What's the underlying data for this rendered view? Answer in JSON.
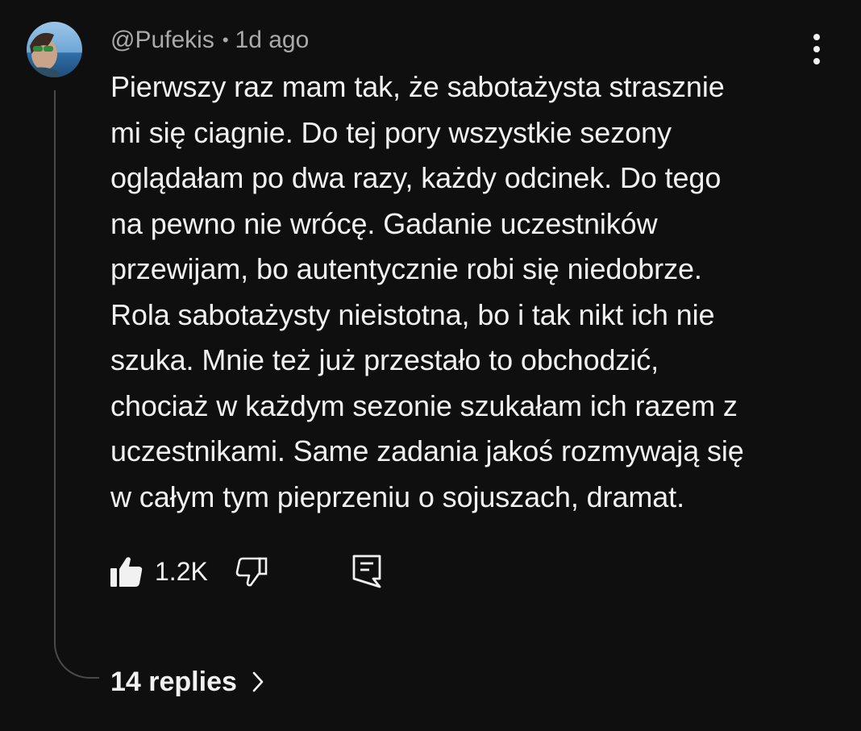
{
  "comment": {
    "author": "@Pufekis",
    "separator": "•",
    "time": "1d ago",
    "lines": [
      "Pierwszy raz mam tak, że sabotażysta strasznie",
      "mi się ciagnie. Do tej pory wszystkie sezony",
      "oglądałam po dwa razy, każdy odcinek. Do tego",
      "na pewno nie wrócę. Gadanie uczestników",
      "przewijam, bo autentycznie robi się niedobrze.",
      "Rola sabotażysty nieistotna, bo i tak nikt ich nie",
      "szuka. Mnie też już przestało to obchodzić,",
      "chociaż w każdym sezonie szukałam ich razem z",
      "uczestnikami. Same zadania jakoś rozmywają się",
      "w całym tym pieprzeniu o sojuszach, dramat."
    ],
    "like_count": "1.2K",
    "replies_label": "14 replies"
  },
  "icons": {
    "avatar": "avatar",
    "menu": "more-vert-icon",
    "like": "thumbs-up-filled-icon",
    "dislike": "thumbs-down-outline-icon",
    "reply": "reply-comment-icon",
    "chevron": "chevron-right-icon"
  },
  "colors": {
    "background": "#0f0f0f",
    "text": "#f1f1f1",
    "secondary_text": "#aaaaaa",
    "thread_line": "#4a4a4a"
  }
}
